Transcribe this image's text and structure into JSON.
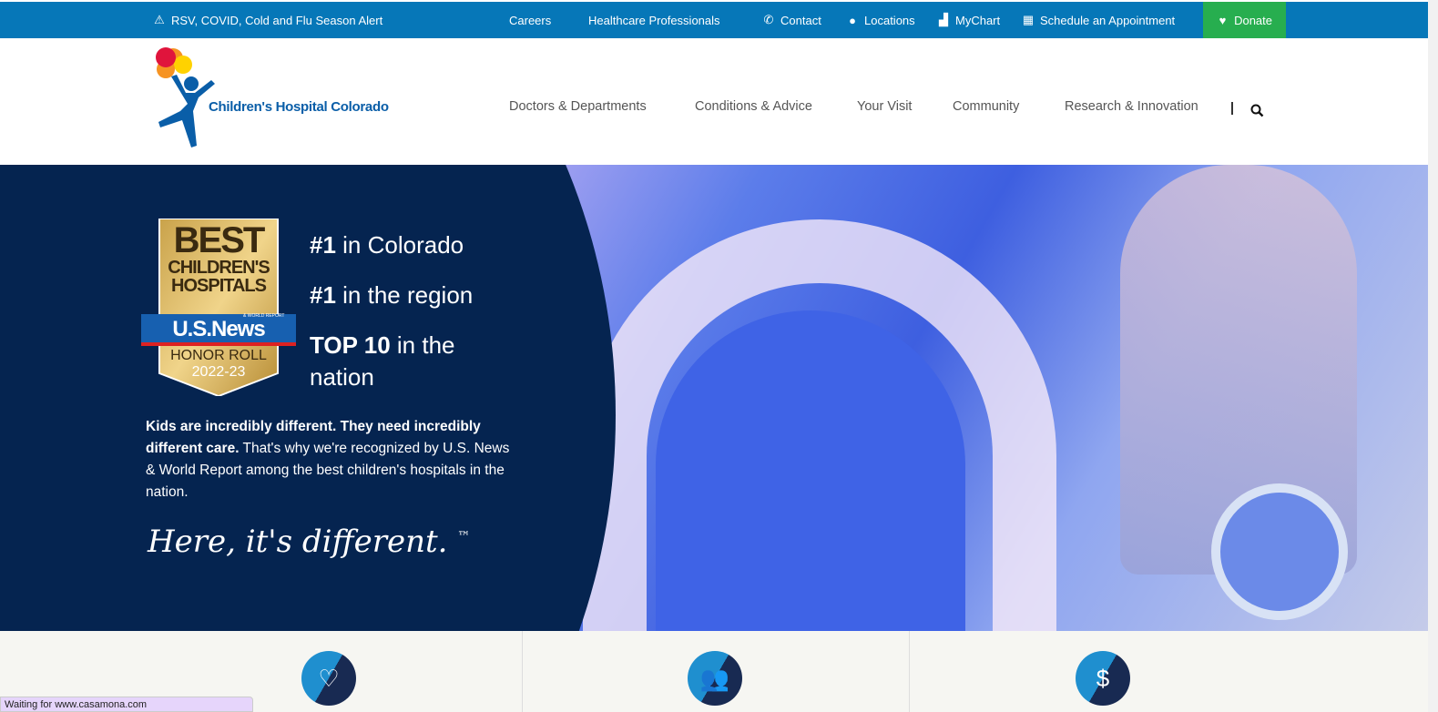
{
  "topbar": {
    "alert": "RSV, COVID, Cold and Flu Season Alert",
    "careers": "Careers",
    "hcp": "Healthcare Professionals",
    "contact": "Contact",
    "locations": "Locations",
    "mychart": "MyChart",
    "schedule": "Schedule an Appointment",
    "donate": "Donate"
  },
  "header": {
    "logo_text": "Children's Hospital Colorado",
    "nav": [
      "Doctors & Departments",
      "Conditions & Advice",
      "Your Visit",
      "Community",
      "Research & Innovation"
    ]
  },
  "hero": {
    "badge": {
      "best": "BEST",
      "line2": "CHILDREN'S",
      "line3": "HOSPITALS",
      "usnews": "U.S.News",
      "wr": "& WORLD REPORT",
      "honor": "HONOR ROLL",
      "years": "2022-23"
    },
    "ranks": [
      {
        "b": "#1",
        "t": " in Colorado"
      },
      {
        "b": "#1",
        "t": " in the region"
      },
      {
        "b": "TOP 10",
        "t": " in the"
      }
    ],
    "rank_cont": "nation",
    "para_bold": "Kids are incredibly different. They need incredibly different care.",
    "para": "  That's why we're recognized by U.S. News & World Report among the best children's hospitals in the nation.",
    "tagline": "Here, it's different.",
    "tm": "™"
  },
  "status": "Waiting for www.casamona.com",
  "colors": {
    "topbar": "#0677b8",
    "donate": "#27ae4f",
    "navy": "#052450"
  }
}
